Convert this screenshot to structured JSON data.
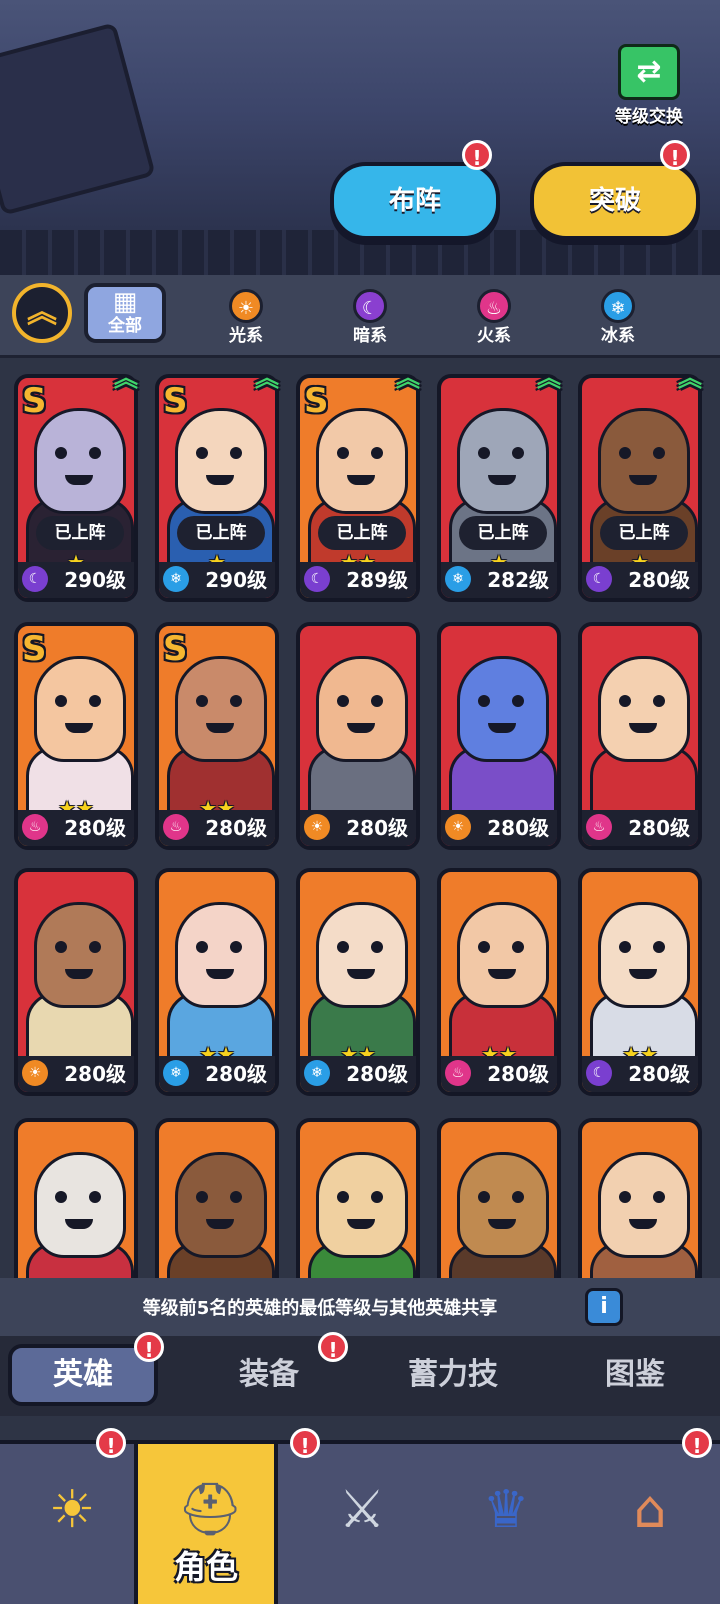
{
  "header": {
    "level_swap_label": "等级交换",
    "formation_button": "布阵",
    "breakthrough_button": "突破"
  },
  "filters": {
    "all_label": "全部",
    "elements": [
      {
        "label": "光系",
        "icon": "light-element-icon",
        "color": "#f08a24"
      },
      {
        "label": "暗系",
        "icon": "dark-element-icon",
        "color": "#8a3fd0"
      },
      {
        "label": "火系",
        "icon": "fire-element-icon",
        "color": "#e0358a"
      },
      {
        "label": "冰系",
        "icon": "ice-element-icon",
        "color": "#2a9ee6"
      }
    ]
  },
  "heroes": [
    {
      "rank": "S",
      "deployed": "已上阵",
      "stars": 1,
      "level": "290级",
      "element": "dark",
      "bg": "red",
      "upgrade": true,
      "tone": "#b9b3d8",
      "body": "#2a2233"
    },
    {
      "rank": "S",
      "deployed": "已上阵",
      "stars": 1,
      "level": "290级",
      "element": "ice",
      "bg": "red",
      "upgrade": true,
      "tone": "#f4d6bd",
      "body": "#2a5fb0"
    },
    {
      "rank": "S",
      "deployed": "已上阵",
      "stars": 2,
      "level": "289级",
      "element": "dark",
      "bg": "orange",
      "upgrade": true,
      "tone": "#f2c9a8",
      "body": "#c03a2c"
    },
    {
      "rank": "",
      "deployed": "已上阵",
      "stars": 1,
      "level": "282级",
      "element": "ice",
      "bg": "red",
      "upgrade": true,
      "tone": "#9ea6b8",
      "body": "#6c7486"
    },
    {
      "rank": "",
      "deployed": "已上阵",
      "stars": 1,
      "level": "280级",
      "element": "dark",
      "bg": "red",
      "upgrade": true,
      "tone": "#8a5a3c",
      "body": "#6a4028"
    },
    {
      "rank": "S",
      "deployed": "",
      "stars": 2,
      "level": "280级",
      "element": "fire",
      "bg": "orange",
      "upgrade": false,
      "tone": "#f4c6a0",
      "body": "#f0e0e6"
    },
    {
      "rank": "S",
      "deployed": "",
      "stars": 2,
      "level": "280级",
      "element": "fire",
      "bg": "orange",
      "upgrade": false,
      "tone": "#c98a6a",
      "body": "#a03030"
    },
    {
      "rank": "",
      "deployed": "",
      "stars": 0,
      "level": "280级",
      "element": "light",
      "bg": "red",
      "upgrade": false,
      "tone": "#f0b890",
      "body": "#6a6f80"
    },
    {
      "rank": "",
      "deployed": "",
      "stars": 0,
      "level": "280级",
      "element": "light",
      "bg": "red",
      "upgrade": false,
      "tone": "#5f7fe0",
      "body": "#7a4ec8"
    },
    {
      "rank": "",
      "deployed": "",
      "stars": 0,
      "level": "280级",
      "element": "fire",
      "bg": "red",
      "upgrade": false,
      "tone": "#f4d0b0",
      "body": "#d03038"
    },
    {
      "rank": "",
      "deployed": "",
      "stars": 0,
      "level": "280级",
      "element": "light",
      "bg": "red",
      "upgrade": false,
      "tone": "#b07a58",
      "body": "#e8d8b0"
    },
    {
      "rank": "",
      "deployed": "",
      "stars": 2,
      "level": "280级",
      "element": "ice",
      "bg": "orange",
      "upgrade": false,
      "tone": "#f4d4c8",
      "body": "#5aa6e0"
    },
    {
      "rank": "",
      "deployed": "",
      "stars": 2,
      "level": "280级",
      "element": "ice",
      "bg": "orange",
      "upgrade": false,
      "tone": "#f4dcc8",
      "body": "#3a7a4a"
    },
    {
      "rank": "",
      "deployed": "",
      "stars": 2,
      "level": "280级",
      "element": "fire",
      "bg": "orange",
      "upgrade": false,
      "tone": "#f2c8a6",
      "body": "#c8303a"
    },
    {
      "rank": "",
      "deployed": "",
      "stars": 2,
      "level": "280级",
      "element": "dark",
      "bg": "orange",
      "upgrade": false,
      "tone": "#f4dcc6",
      "body": "#d8dce6"
    },
    {
      "rank": "",
      "deployed": "",
      "stars": 0,
      "level": "",
      "element": "",
      "bg": "orange",
      "upgrade": false,
      "tone": "#e8e4e0",
      "body": "#c83040"
    },
    {
      "rank": "",
      "deployed": "",
      "stars": 0,
      "level": "",
      "element": "",
      "bg": "orange",
      "upgrade": false,
      "tone": "#8a5a3c",
      "body": "#6a4028"
    },
    {
      "rank": "",
      "deployed": "",
      "stars": 0,
      "level": "",
      "element": "",
      "bg": "orange",
      "upgrade": false,
      "tone": "#f0d0a0",
      "body": "#3a8a3a"
    },
    {
      "rank": "",
      "deployed": "",
      "stars": 0,
      "level": "",
      "element": "",
      "bg": "orange",
      "upgrade": false,
      "tone": "#c08a50",
      "body": "#5a3a2a"
    },
    {
      "rank": "",
      "deployed": "",
      "stars": 0,
      "level": "",
      "element": "",
      "bg": "orange",
      "upgrade": false,
      "tone": "#f2d0b0",
      "body": "#a06040"
    }
  ],
  "element_colors": {
    "dark": "#7a3fd0",
    "ice": "#2a9ee6",
    "fire": "#e0358a",
    "light": "#f08a24"
  },
  "element_glyphs": {
    "dark": "☾",
    "ice": "❄",
    "fire": "♨",
    "light": "☀"
  },
  "note": "等级前5名的英雄的最低等级与其他英雄共享",
  "subtabs": [
    "英雄",
    "装备",
    "蓄力技",
    "图鉴"
  ],
  "nav": {
    "active_label": "角色"
  }
}
